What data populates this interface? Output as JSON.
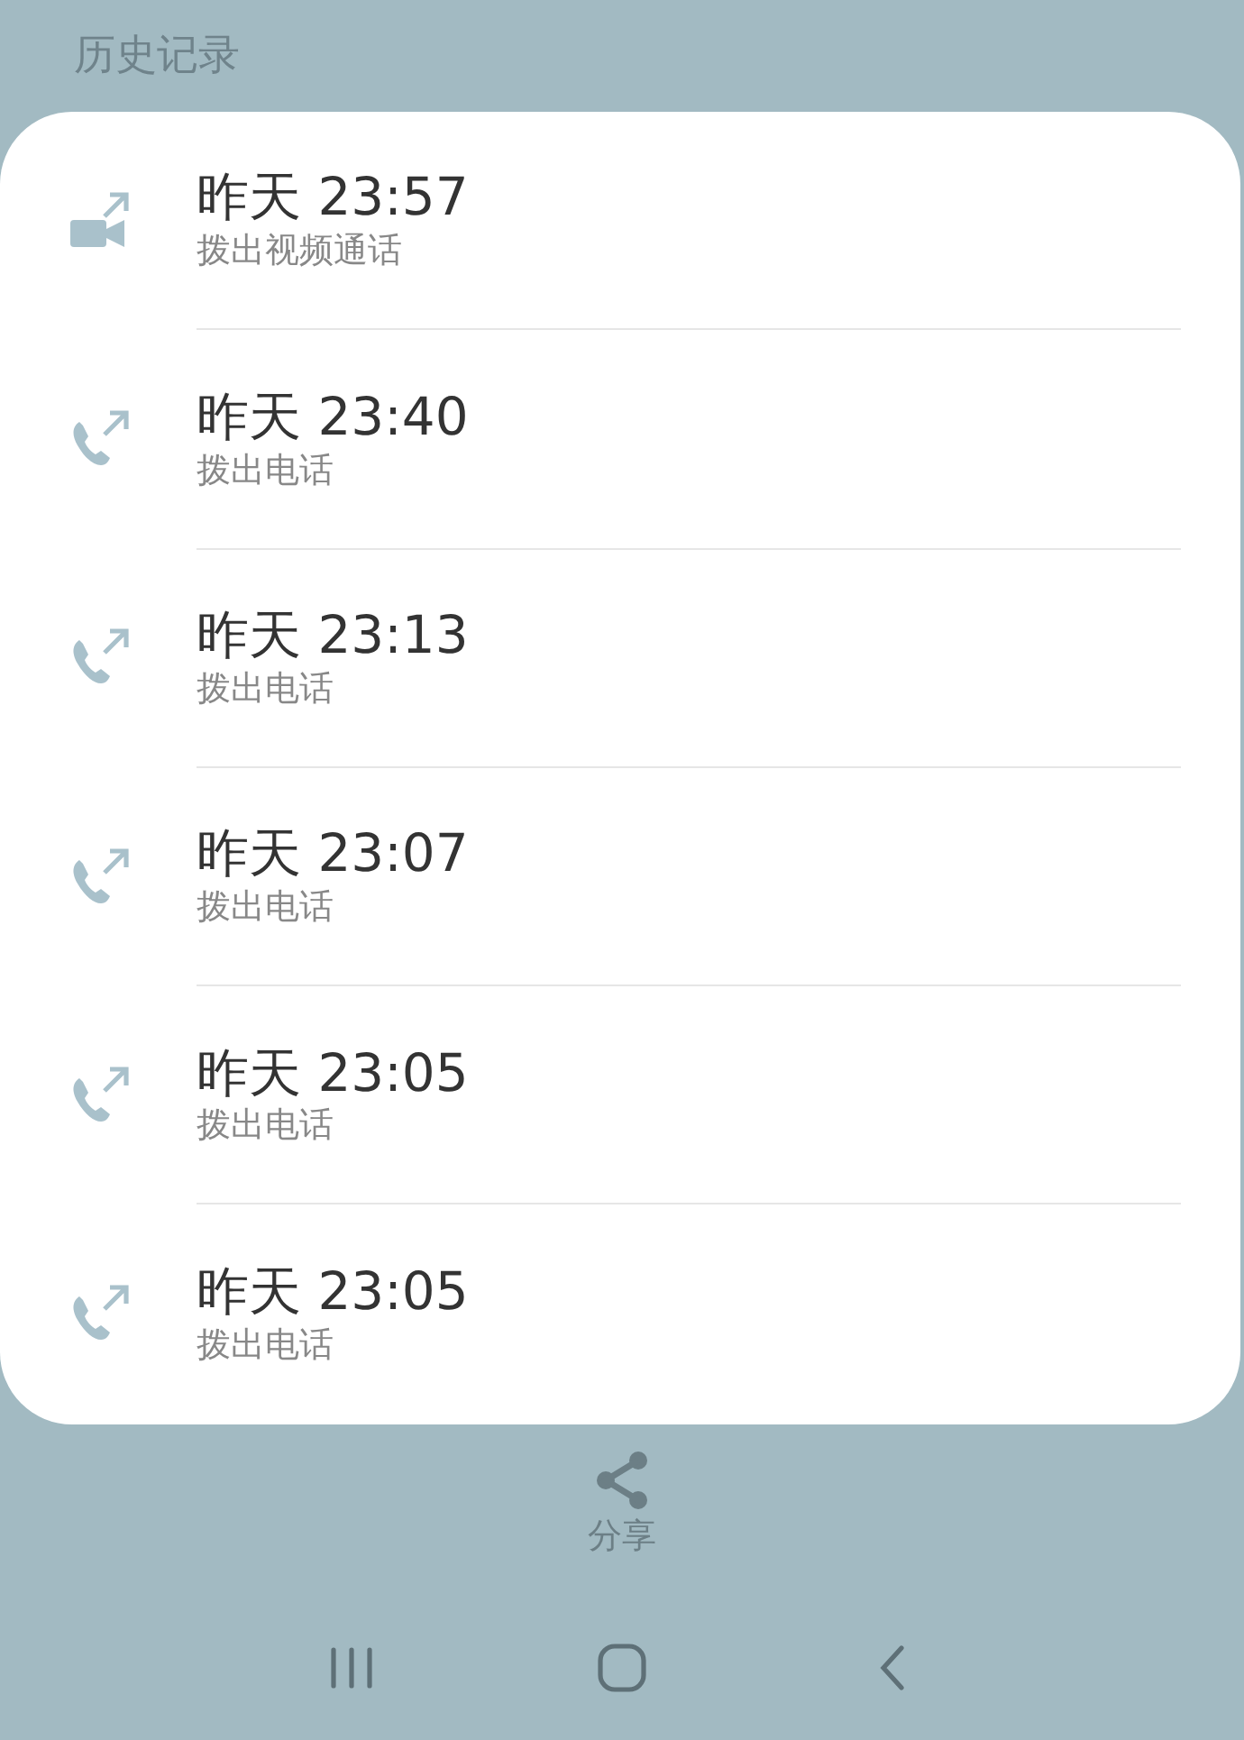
{
  "header": {
    "title": "历史记录"
  },
  "calls": [
    {
      "kind": "video",
      "time": "昨天 23:57",
      "description": "拨出视频通话"
    },
    {
      "kind": "voice",
      "time": "昨天 23:40",
      "description": "拨出电话"
    },
    {
      "kind": "voice",
      "time": "昨天 23:13",
      "description": "拨出电话"
    },
    {
      "kind": "voice",
      "time": "昨天 23:07",
      "description": "拨出电话"
    },
    {
      "kind": "voice",
      "time": "昨天 23:05",
      "description": "拨出电话"
    },
    {
      "kind": "voice",
      "time": "昨天 23:05",
      "description": "拨出电话"
    }
  ],
  "share": {
    "label": "分享"
  }
}
